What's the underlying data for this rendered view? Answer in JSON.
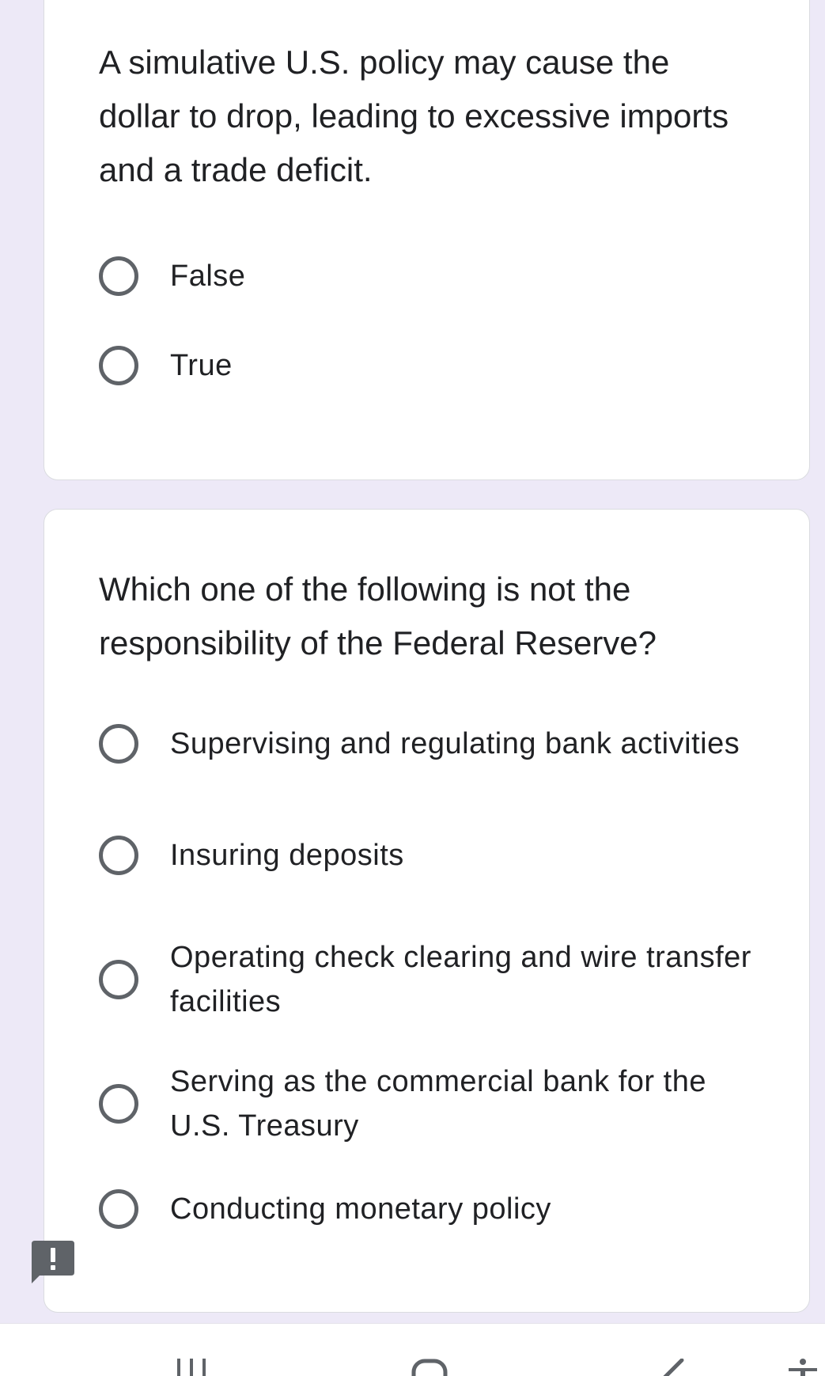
{
  "questions": [
    {
      "text": "A simulative U.S. policy may cause the dollar to drop, leading to excessive imports and a trade deficit.",
      "options": [
        "False",
        "True"
      ]
    },
    {
      "text": "Which one of the following is not the responsibility of the Federal Reserve?",
      "options": [
        "Supervising and regulating bank activities",
        "Insuring deposits",
        "Operating check clearing and wire transfer facilities",
        "Serving as the commercial bank for the U.S. Treasury",
        "Conducting monetary policy"
      ]
    }
  ],
  "feedback": {
    "icon": "report-problem-icon",
    "glyph": "!"
  },
  "navbar": {
    "icons": [
      "recent-apps-icon",
      "home-icon",
      "back-icon",
      "accessibility-icon"
    ]
  },
  "colors": {
    "page_background": "#ede9f7",
    "card_background": "#ffffff",
    "radio_border": "#5f6368",
    "text": "#202124",
    "feedback_badge": "#5f6368"
  }
}
